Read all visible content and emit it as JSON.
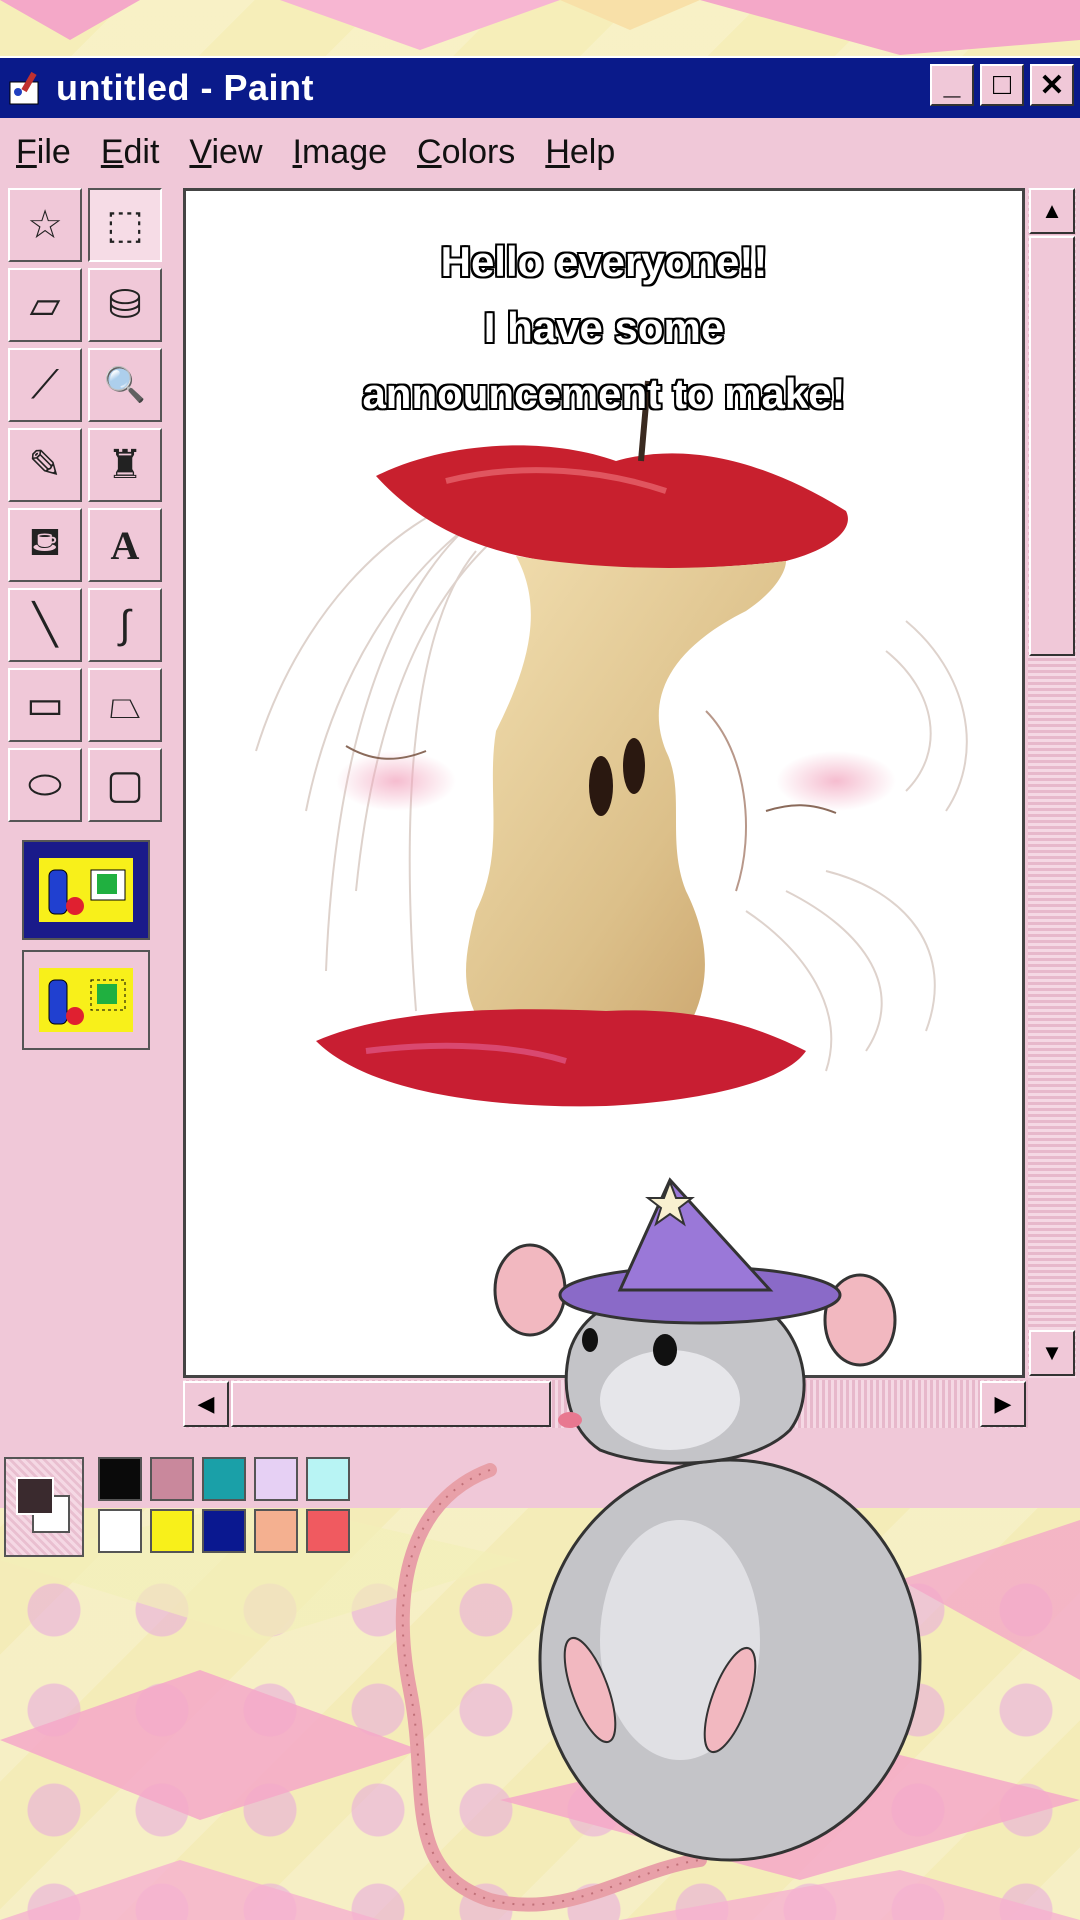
{
  "window": {
    "title": "untitled - Paint"
  },
  "window_buttons": {
    "minimize": "_",
    "maximize": "□",
    "close": "✕"
  },
  "menu": [
    {
      "label": "File",
      "underline": "F",
      "rest": "ile"
    },
    {
      "label": "Edit",
      "underline": "E",
      "rest": "dit"
    },
    {
      "label": "View",
      "underline": "V",
      "rest": "iew"
    },
    {
      "label": "Image",
      "underline": "I",
      "rest": "mage"
    },
    {
      "label": "Colors",
      "underline": "C",
      "rest": "olors"
    },
    {
      "label": "Help",
      "underline": "H",
      "rest": "elp"
    }
  ],
  "tools": [
    {
      "name": "free-form-select-icon",
      "glyph": "☆"
    },
    {
      "name": "select-icon",
      "glyph": "⬚"
    },
    {
      "name": "eraser-icon",
      "glyph": "▱"
    },
    {
      "name": "fill-bucket-icon",
      "glyph": "⛁"
    },
    {
      "name": "color-picker-icon",
      "glyph": "⟋"
    },
    {
      "name": "magnifier-icon",
      "glyph": "🔍"
    },
    {
      "name": "pencil-icon",
      "glyph": "✎"
    },
    {
      "name": "brush-icon",
      "glyph": "♜"
    },
    {
      "name": "airbrush-icon",
      "glyph": "⛾"
    },
    {
      "name": "text-icon",
      "glyph": "A"
    },
    {
      "name": "line-icon",
      "glyph": "╲"
    },
    {
      "name": "curve-icon",
      "glyph": "∫"
    },
    {
      "name": "rectangle-icon",
      "glyph": "▭"
    },
    {
      "name": "polygon-icon",
      "glyph": "⏢"
    },
    {
      "name": "ellipse-icon",
      "glyph": "⬭"
    },
    {
      "name": "rounded-rectangle-icon",
      "glyph": "▢"
    }
  ],
  "caption": {
    "line1": "Hello everyone!!",
    "line2": "I have some",
    "line3": "announcement to make!"
  },
  "palette": {
    "foreground": "#3a2a2e",
    "background": "#ffffff",
    "colors": [
      "#0a0a0a",
      "#c9889c",
      "#1aa0a8",
      "#e6d0f4",
      "#b8f4f4",
      "#ffffff",
      "#f8f01a",
      "#0a1890",
      "#f4b090",
      "#f05a60"
    ]
  },
  "colors": {
    "titlebar": "#0a1a8a",
    "window": "#f0c8d8",
    "background": "#f6eeb9"
  }
}
